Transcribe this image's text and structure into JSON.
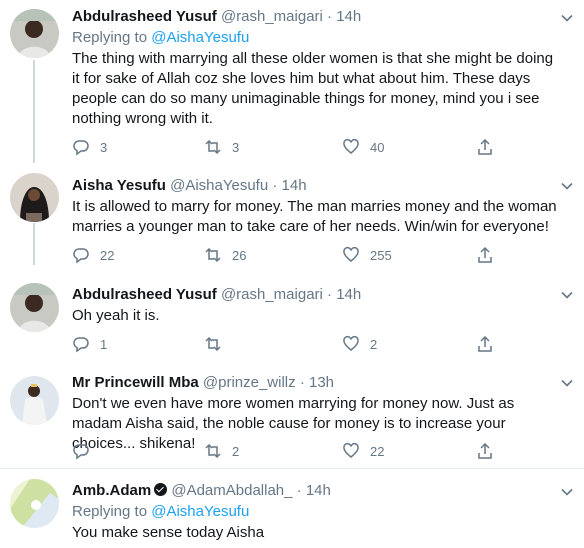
{
  "tweets": [
    {
      "name": "Abdulrasheed Yusuf",
      "handle": "@rash_maigari",
      "dot": "·",
      "time": "14h",
      "replying_prefix": "Replying to ",
      "replying_to": "@AishaYesufu",
      "text": "The thing with marrying all these older women is that she might be doing it for sake of Allah coz she loves him but what about him. These days people can do so many unimaginable things for money, mind you i see nothing wrong with it.",
      "replies": "3",
      "retweets": "3",
      "likes": "40"
    },
    {
      "name": "Aisha Yesufu",
      "handle": "@AishaYesufu",
      "dot": "·",
      "time": "14h",
      "text": "It is allowed to marry for money. The man marries money and the woman marries a younger man to take care of her needs. Win/win for everyone!",
      "replies": "22",
      "retweets": "26",
      "likes": "255"
    },
    {
      "name": "Abdulrasheed Yusuf",
      "handle": "@rash_maigari",
      "dot": "·",
      "time": "14h",
      "text": "Oh yeah it is.",
      "replies": "1",
      "retweets": "",
      "likes": "2"
    },
    {
      "name": "Mr Princewill Mba",
      "handle": "@prinze_willz",
      "dot": "·",
      "time": "13h",
      "text": "Don't we even have more women marrying for money now. Just as madam Aisha said, the noble cause for money is to increase your choices... shikena!",
      "replies": "",
      "retweets": "2",
      "likes": "22"
    },
    {
      "name": "Amb.Adam",
      "handle": "@AdamAbdallah_",
      "dot": "·",
      "time": "14h",
      "replying_prefix": "Replying to ",
      "replying_to": "@AishaYesufu",
      "text": "You make sense today Aisha"
    }
  ],
  "icons": {
    "reply": "reply-icon",
    "retweet": "retweet-icon",
    "like": "heart-icon",
    "share": "share-icon",
    "caret": "chevron-down-icon",
    "verified": "verified-badge-icon"
  },
  "colors": {
    "link": "#1da1f2",
    "meta": "#657786",
    "thread_line": "#ccd6dd"
  }
}
